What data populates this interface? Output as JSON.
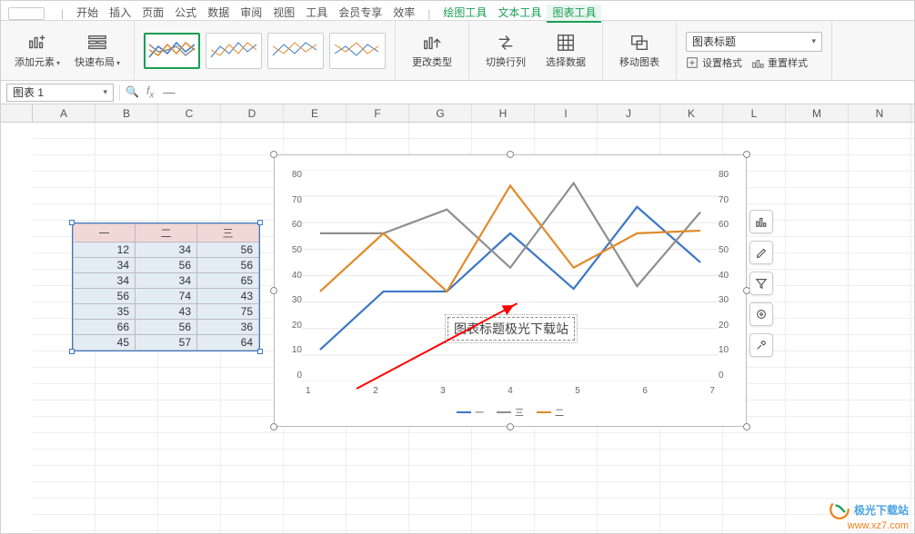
{
  "tabs": {
    "menu": [
      "开始",
      "插入",
      "页面",
      "公式",
      "数据",
      "审阅",
      "视图",
      "工具",
      "会员专享",
      "效率"
    ],
    "context": [
      "绘图工具",
      "文本工具",
      "图表工具"
    ],
    "active": "图表工具"
  },
  "ribbon": {
    "addElement": "添加元素",
    "quickLayout": "快速布局",
    "changeType": "更改类型",
    "switchRC": "切换行列",
    "selectData": "选择数据",
    "moveChart": "移动图表",
    "styleSelect": "图表标题",
    "setFormat": "设置格式",
    "resetStyle": "重置样式"
  },
  "namebox": "图表 1",
  "fx_placeholder": "—",
  "columns": [
    "A",
    "B",
    "C",
    "D",
    "E",
    "F",
    "G",
    "H",
    "I",
    "J",
    "K",
    "L",
    "M",
    "N"
  ],
  "table": {
    "headers": [
      "一",
      "二",
      "三"
    ],
    "rows": [
      [
        12,
        34,
        56
      ],
      [
        34,
        56,
        56
      ],
      [
        34,
        34,
        65
      ],
      [
        56,
        74,
        43
      ],
      [
        35,
        43,
        75
      ],
      [
        66,
        56,
        36
      ],
      [
        45,
        57,
        64
      ]
    ]
  },
  "chart_data": {
    "type": "line",
    "categories": [
      "1",
      "2",
      "3",
      "4",
      "5",
      "6",
      "7"
    ],
    "series": [
      {
        "name": "一",
        "color": "#3b78c4",
        "values": [
          12,
          34,
          34,
          56,
          35,
          66,
          45
        ]
      },
      {
        "name": "三",
        "color": "#8f8f8f",
        "values": [
          56,
          56,
          65,
          43,
          75,
          36,
          64
        ]
      },
      {
        "name": "二",
        "color": "#e08a2a",
        "values": [
          34,
          56,
          34,
          74,
          43,
          56,
          57
        ]
      }
    ],
    "ylim": [
      0,
      80
    ],
    "yticks": [
      0,
      10,
      20,
      30,
      40,
      50,
      60,
      70,
      80
    ],
    "y2ticks": [
      0,
      10,
      20,
      30,
      40,
      50,
      60,
      70,
      80
    ],
    "title_editing": "图表标题极光下载站",
    "legend": [
      "一",
      "三",
      "二"
    ]
  },
  "sidebuttons": [
    "chart-elements-icon",
    "style-brush-icon",
    "filter-icon",
    "settings-gear-icon",
    "tools-icon"
  ],
  "watermark": {
    "brand": "极光下载站",
    "url": "www.xz7.com"
  }
}
